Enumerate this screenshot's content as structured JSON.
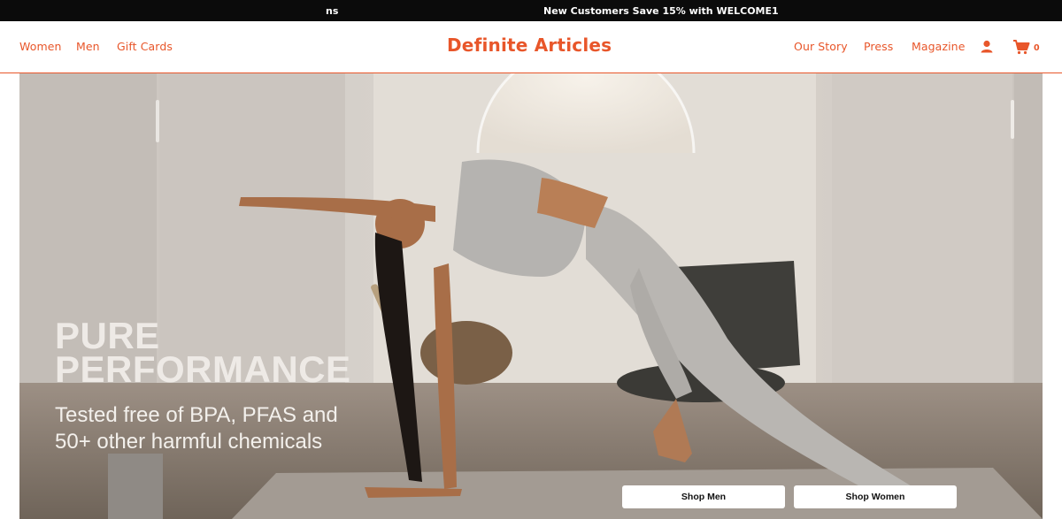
{
  "announcement": {
    "fragment": "ns",
    "message": "New Customers Save 15% with WELCOME1"
  },
  "header": {
    "brand": "Definite Articles",
    "nav_left": [
      "Women",
      "Men",
      "Gift Cards"
    ],
    "nav_right": [
      "Our Story",
      "Press",
      "Magazine"
    ],
    "account_icon": "user-icon",
    "cart_icon": "cart-icon",
    "cart_count": "0"
  },
  "hero": {
    "headline_line1": "PURE",
    "headline_line2": "PERFORMANCE",
    "subtext": "Tested free of BPA, PFAS and 50+ other harmful chemicals",
    "shop_men_label": "Shop Men",
    "shop_women_label": "Shop Women"
  },
  "colors": {
    "accent": "#e8562a",
    "announcement_bg": "#0b0b0b",
    "button_bg": "#ffffff"
  }
}
